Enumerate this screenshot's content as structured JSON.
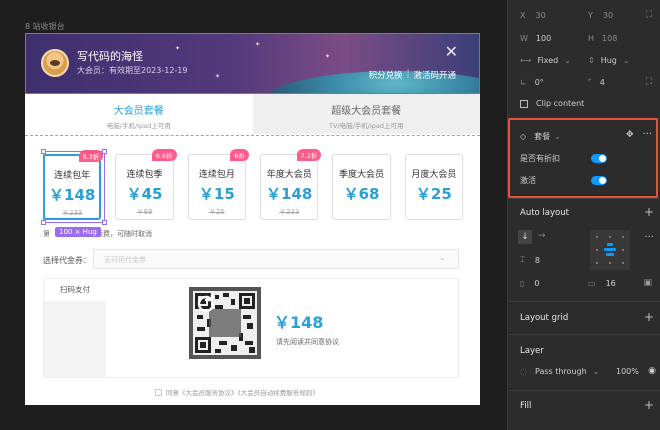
{
  "frame": {
    "label": "8 站收银台"
  },
  "banner": {
    "user_name": "写代码的海怪",
    "membership": "大会员：有效期至2023-12-19",
    "link_redeem": "积分兑换",
    "separator": "|",
    "link_activate": "激活码开通",
    "close_icon": "close-icon"
  },
  "tabs": [
    {
      "title": "大会员套餐",
      "subtitle": "电脑/手机/ipad上可用",
      "active": true
    },
    {
      "title": "超级大会员套餐",
      "subtitle": "TV/电脑/手机/ipad上可用",
      "active": false
    }
  ],
  "plans": [
    {
      "name": "连续包年",
      "price": "￥148",
      "original": "￥233",
      "badge": "6.3折",
      "selected": true
    },
    {
      "name": "连续包季",
      "price": "￥45",
      "original": "￥68",
      "badge": "6.6折",
      "selected": false
    },
    {
      "name": "连续包月",
      "price": "￥15",
      "original": "￥25",
      "badge": "6折",
      "selected": false
    },
    {
      "name": "年度大会员",
      "price": "￥148",
      "original": "￥233",
      "badge": "7.2折",
      "selected": false
    },
    {
      "name": "季度大会员",
      "price": "￥68",
      "original": "",
      "badge": "",
      "selected": false
    },
    {
      "name": "月度大会员",
      "price": "￥25",
      "original": "",
      "badge": "",
      "selected": false
    }
  ],
  "selection": {
    "size_tag": "100 × Hug"
  },
  "note": {
    "prefix": "第",
    "tail": "动续费，可随时取消"
  },
  "coupon": {
    "label": "选择代金券：",
    "placeholder": "无可用代金券"
  },
  "payment": {
    "method_label": "扫码支付",
    "price": "￥148",
    "hint": "请先阅读并同意协议",
    "refresh_icon": "refresh-icon"
  },
  "agreement": {
    "text": "同意《大会员服务协议》《大会员自动续费服务规则》"
  },
  "panel": {
    "x_label": "X",
    "x_value": "30",
    "y_label": "Y",
    "y_value": "30",
    "w_label": "W",
    "w_value": "100",
    "h_label": "H",
    "h_value": "108",
    "width_mode": "Fixed",
    "height_mode": "Hug",
    "rotation": "0°",
    "radius": "4",
    "clip_content": "Clip content",
    "component_name": "套餐",
    "prop_discount": "是否有折扣",
    "prop_active": "激活",
    "auto_layout": "Auto layout",
    "spacing": "8",
    "padding_h": "0",
    "padding_v": "16",
    "layout_grid": "Layout grid",
    "layer": "Layer",
    "blend_mode": "Pass through",
    "opacity": "100%",
    "fill": "Fill"
  },
  "colors": {
    "accent": "#2a9fd6",
    "badge": "#ff5c8a",
    "toggle": "#0d99ff",
    "highlight": "#e5533c"
  }
}
